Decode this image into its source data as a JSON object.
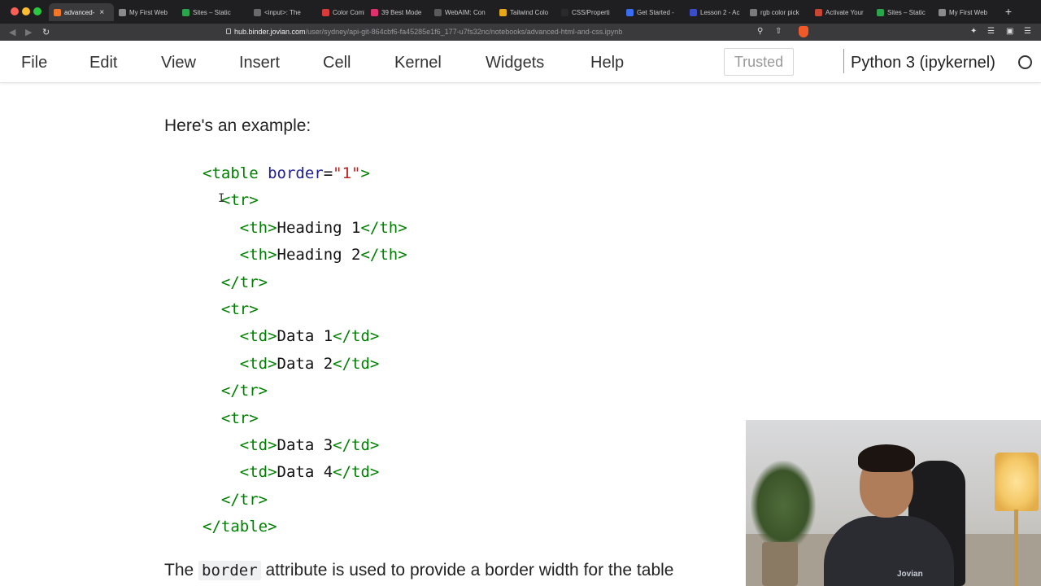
{
  "browser": {
    "tabs": [
      {
        "label": "advanced-",
        "color": "#f37626",
        "active": true
      },
      {
        "label": "My First Web",
        "color": "#8a8a8a"
      },
      {
        "label": "Sites – Static",
        "color": "#2aa54b"
      },
      {
        "label": "<input>: The",
        "color": "#6a6a6a"
      },
      {
        "label": "Color Combin",
        "color": "#d93a3a"
      },
      {
        "label": "39 Best Mode",
        "color": "#e0306e"
      },
      {
        "label": "WebAIM: Con",
        "color": "#5a5a5a"
      },
      {
        "label": "Tailwind Colo",
        "color": "#e6a817"
      },
      {
        "label": "CSS/Properti",
        "color": "#2a2a2a"
      },
      {
        "label": "Get Started -",
        "color": "#3a6df0"
      },
      {
        "label": "Lesson 2 - Ac",
        "color": "#3a4cc8"
      },
      {
        "label": "rgb color pick",
        "color": "#7a7a7a"
      },
      {
        "label": "Activate Your",
        "color": "#c74634"
      },
      {
        "label": "Sites – Static",
        "color": "#2aa54b"
      },
      {
        "label": "My First Web",
        "color": "#8a8a8a"
      }
    ],
    "url_host": "hub.binder.jovian.com",
    "url_path": "/user/sydney/api-git-864cbf6-fa45285e1f6_177-u7fs32nc/notebooks/advanced-html-and-css.ipynb"
  },
  "menu": {
    "items": [
      "File",
      "Edit",
      "View",
      "Insert",
      "Cell",
      "Kernel",
      "Widgets",
      "Help"
    ],
    "trusted": "Trusted",
    "kernel": "Python 3 (ipykernel)"
  },
  "content": {
    "intro": "Here's an example:",
    "code_lines": [
      [
        [
          "tag",
          "<table "
        ],
        [
          "attr",
          "border"
        ],
        [
          "txt",
          "="
        ],
        [
          "val",
          "\"1\""
        ],
        [
          "tag",
          ">"
        ]
      ],
      [
        [
          "txt",
          "  "
        ],
        [
          "tag",
          "<tr>"
        ]
      ],
      [
        [
          "txt",
          "    "
        ],
        [
          "tag",
          "<th>"
        ],
        [
          "txt",
          "Heading 1"
        ],
        [
          "tag",
          "</th>"
        ]
      ],
      [
        [
          "txt",
          "    "
        ],
        [
          "tag",
          "<th>"
        ],
        [
          "txt",
          "Heading 2"
        ],
        [
          "tag",
          "</th>"
        ]
      ],
      [
        [
          "txt",
          "  "
        ],
        [
          "tag",
          "</tr>"
        ]
      ],
      [
        [
          "txt",
          "  "
        ],
        [
          "tag",
          "<tr>"
        ]
      ],
      [
        [
          "txt",
          "    "
        ],
        [
          "tag",
          "<td>"
        ],
        [
          "txt",
          "Data 1"
        ],
        [
          "tag",
          "</td>"
        ]
      ],
      [
        [
          "txt",
          "    "
        ],
        [
          "tag",
          "<td>"
        ],
        [
          "txt",
          "Data 2"
        ],
        [
          "tag",
          "</td>"
        ]
      ],
      [
        [
          "txt",
          "  "
        ],
        [
          "tag",
          "</tr>"
        ]
      ],
      [
        [
          "txt",
          "  "
        ],
        [
          "tag",
          "<tr>"
        ]
      ],
      [
        [
          "txt",
          "    "
        ],
        [
          "tag",
          "<td>"
        ],
        [
          "txt",
          "Data 3"
        ],
        [
          "tag",
          "</td>"
        ]
      ],
      [
        [
          "txt",
          "    "
        ],
        [
          "tag",
          "<td>"
        ],
        [
          "txt",
          "Data 4"
        ],
        [
          "tag",
          "</td>"
        ]
      ],
      [
        [
          "txt",
          "  "
        ],
        [
          "tag",
          "</tr>"
        ]
      ],
      [
        [
          "tag",
          "</table>"
        ]
      ]
    ],
    "explain_before": "The ",
    "explain_code": "border",
    "explain_after": " attribute is used to provide a border width for the table"
  },
  "webcam": {
    "shirt_logo": "Jovian"
  },
  "colors": {
    "tag": "#008000",
    "attr": "#1f1f8f",
    "value": "#ba2121"
  }
}
